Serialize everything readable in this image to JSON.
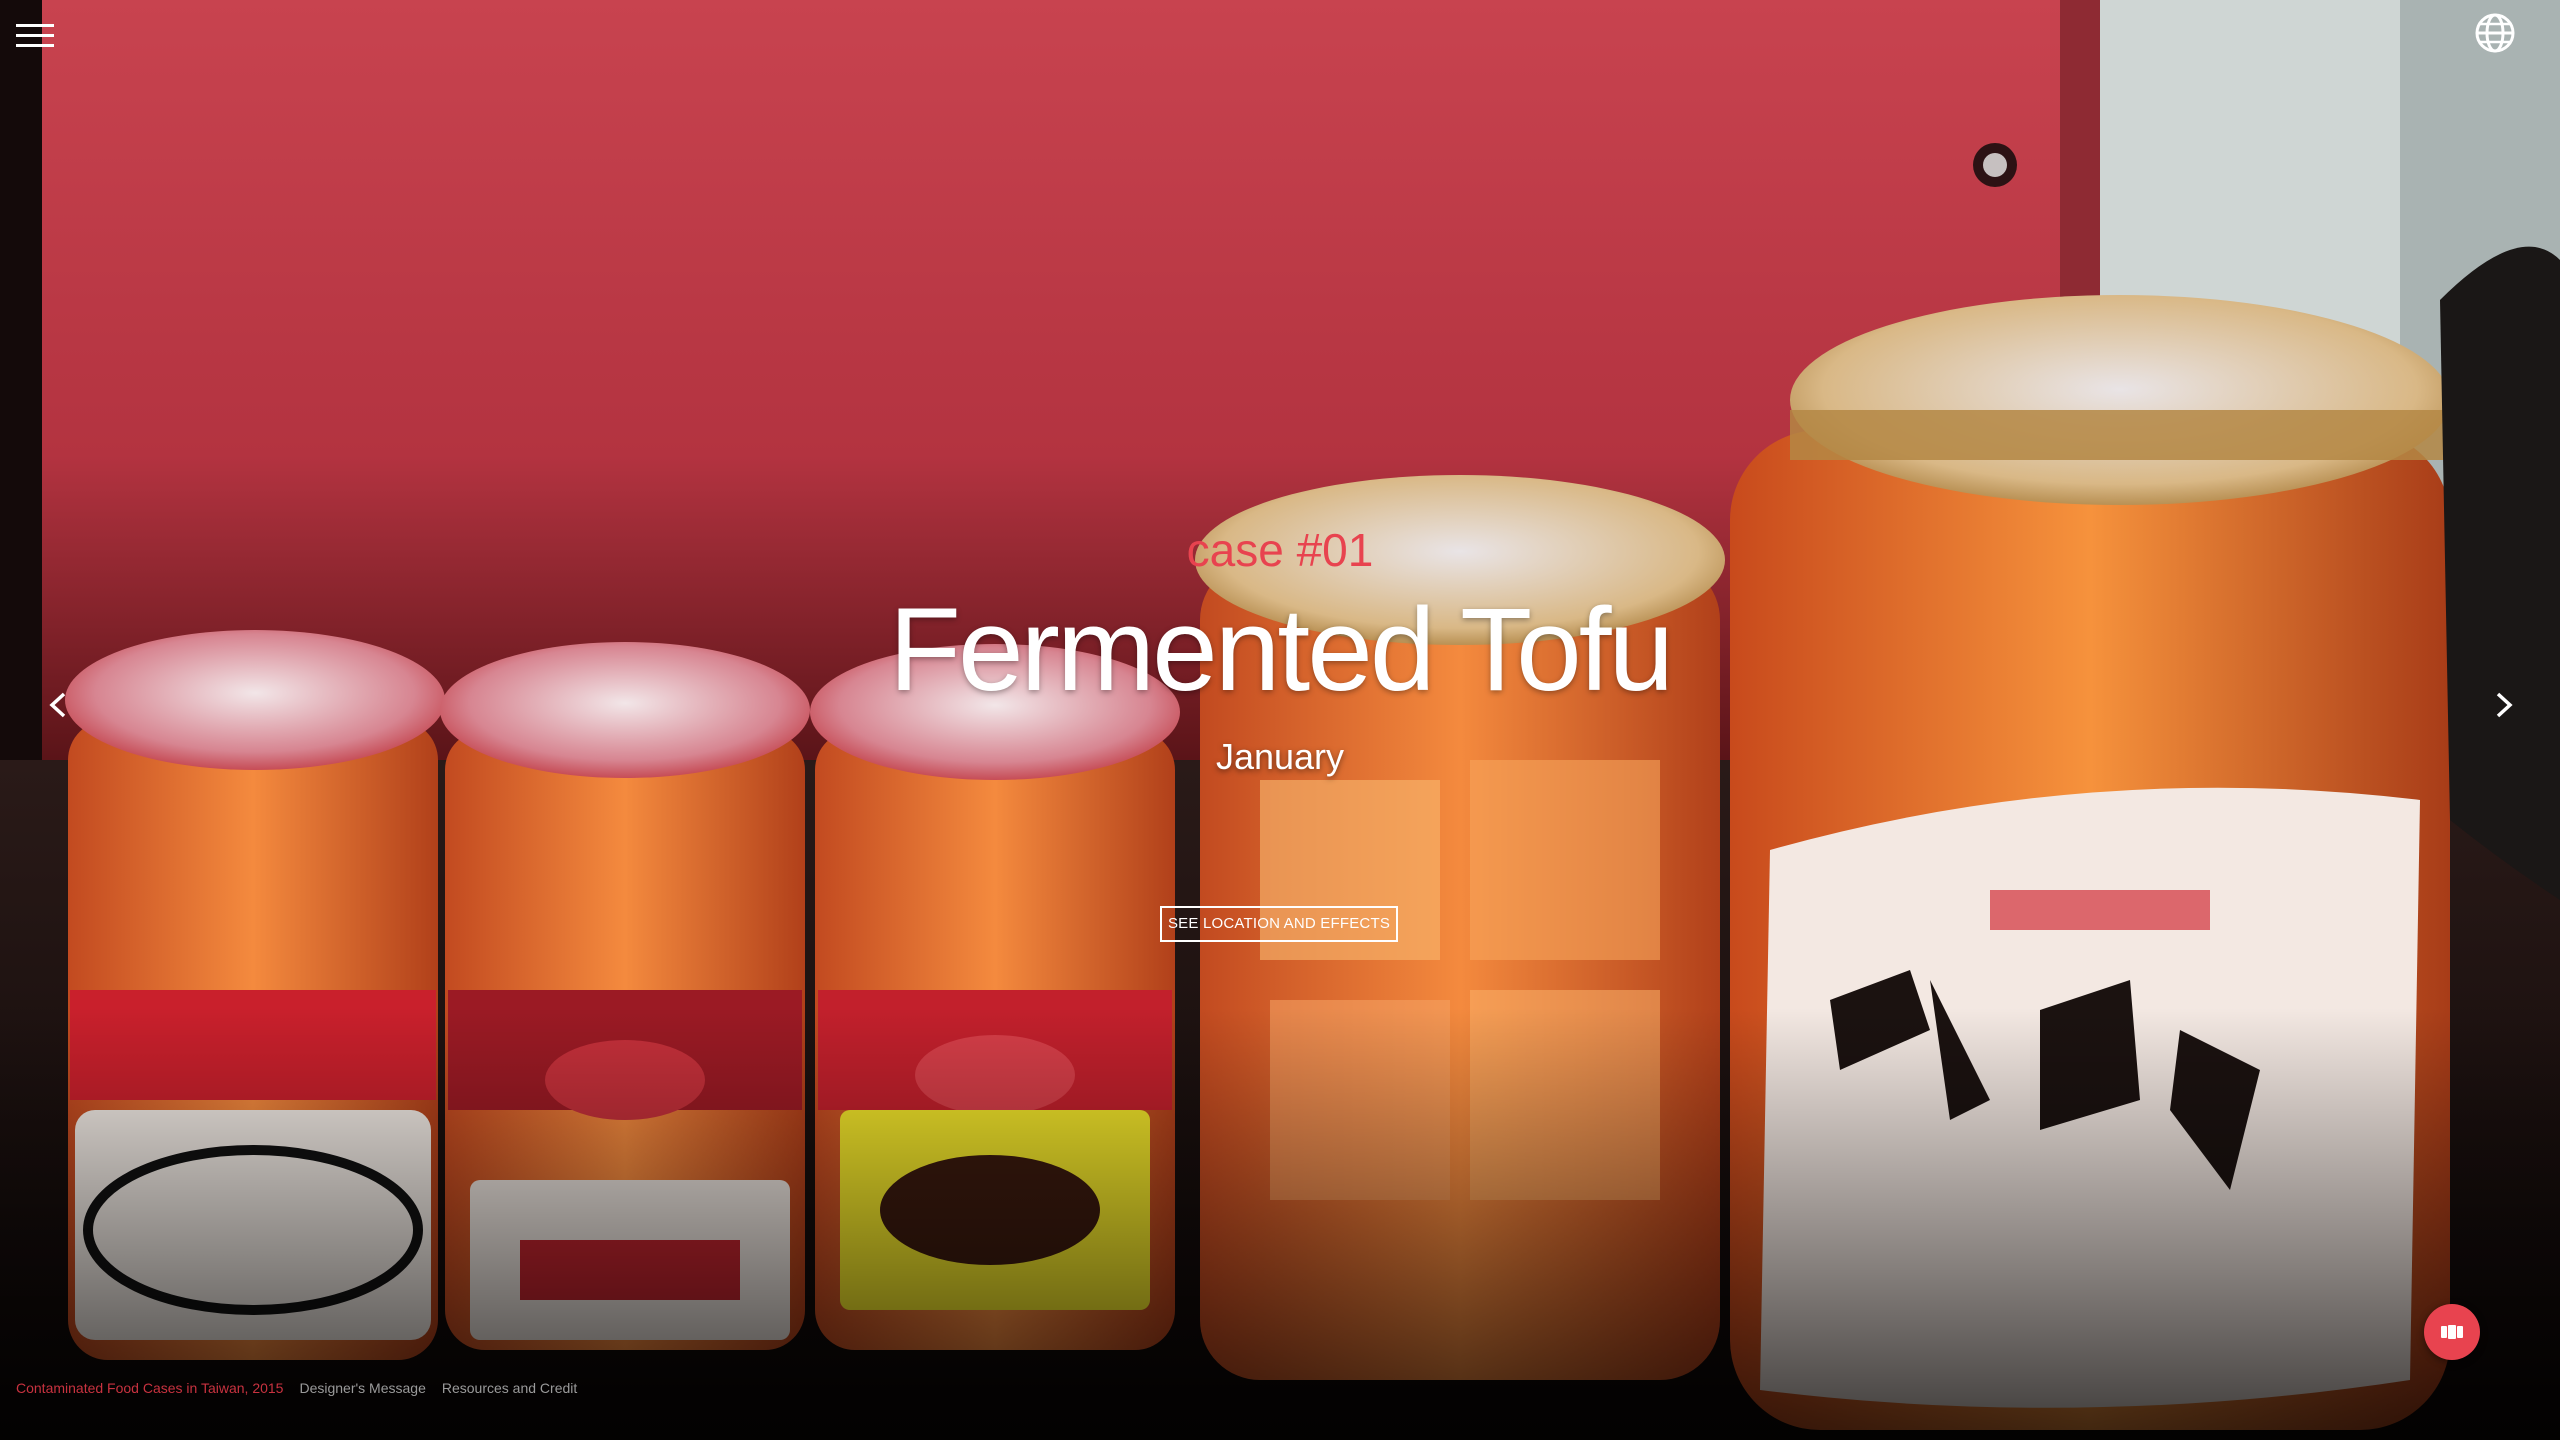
{
  "header": {
    "menu_icon": "hamburger-menu-icon",
    "language_icon": "globe-icon"
  },
  "hero": {
    "case_label": "case #01",
    "title": "Fermented Tofu",
    "month": "January",
    "cta_label": "SEE LOCATION AND EFFECTS"
  },
  "navigation": {
    "prev_icon": "chevron-left-icon",
    "next_icon": "chevron-right-icon"
  },
  "footer": {
    "links": [
      "Contaminated Food Cases in Taiwan, 2015",
      "Designer's Message",
      "Resources and Credit"
    ]
  },
  "fab": {
    "icon": "video-icon"
  },
  "colors": {
    "accent": "#e8434f",
    "background_red": "#c8323f",
    "text": "#ffffff",
    "muted_link": "#9a9a9a"
  }
}
